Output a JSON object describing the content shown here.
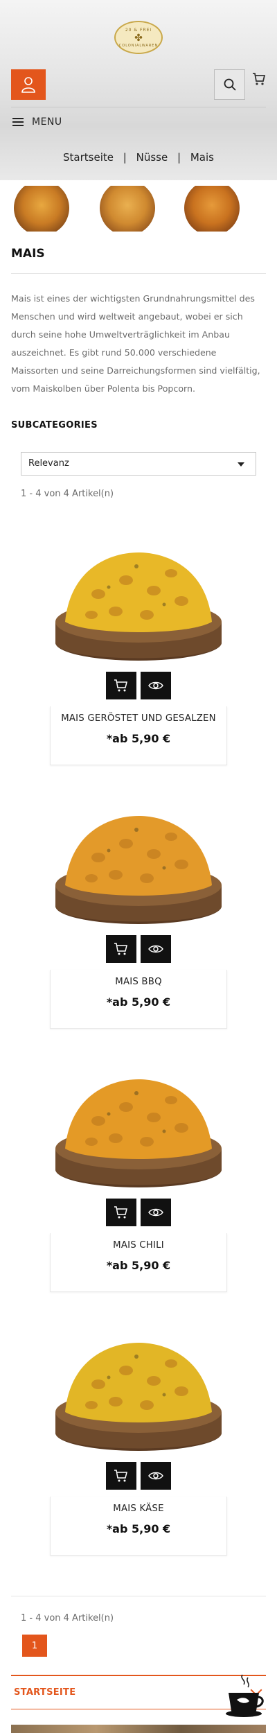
{
  "header": {
    "logo": {
      "top": "20 & FREI",
      "middle": "✤",
      "bottom": "COLONIALWAREN"
    }
  },
  "menu": {
    "label": "MENU"
  },
  "breadcrumb": {
    "items": [
      "Startseite",
      "Nüsse",
      "Mais"
    ],
    "separator": "|"
  },
  "category": {
    "title": "MAIS",
    "description": "Mais ist eines der wichtigsten Grundnahrungsmittel des Menschen und wird weltweit angebaut, wobei er sich durch seine hohe Umweltverträglichkeit im Anbau auszeichnet. Es gibt rund 50.000 verschiedene Maissorten und seine Darreichungsformen sind vielfältig, vom Maiskolben über Polenta bis Popcorn."
  },
  "subcategories": {
    "heading": "SUBCATEGORIES"
  },
  "sort": {
    "selected": "Relevanz"
  },
  "listing": {
    "count_text": "1 - 4 von 4 Artikel(n)"
  },
  "products": [
    {
      "name": "MAIS GERÖSTET UND GESALZEN",
      "price": "*ab 5,90 €",
      "tint": "#e8b828"
    },
    {
      "name": "MAIS BBQ",
      "price": "*ab 5,90 €",
      "tint": "#e39a2a"
    },
    {
      "name": "MAIS CHILI",
      "price": "*ab 5,90 €",
      "tint": "#e49a26"
    },
    {
      "name": "MAIS KÄSE",
      "price": "*ab 5,90 €",
      "tint": "#e2b626"
    }
  ],
  "pagination": {
    "count_text": "1 - 4 von 4 Artikel(n)",
    "current_page": "1"
  },
  "footer": {
    "section_label": "STARTSEITE"
  },
  "colors": {
    "accent": "#e3561c",
    "dark": "#111111"
  }
}
